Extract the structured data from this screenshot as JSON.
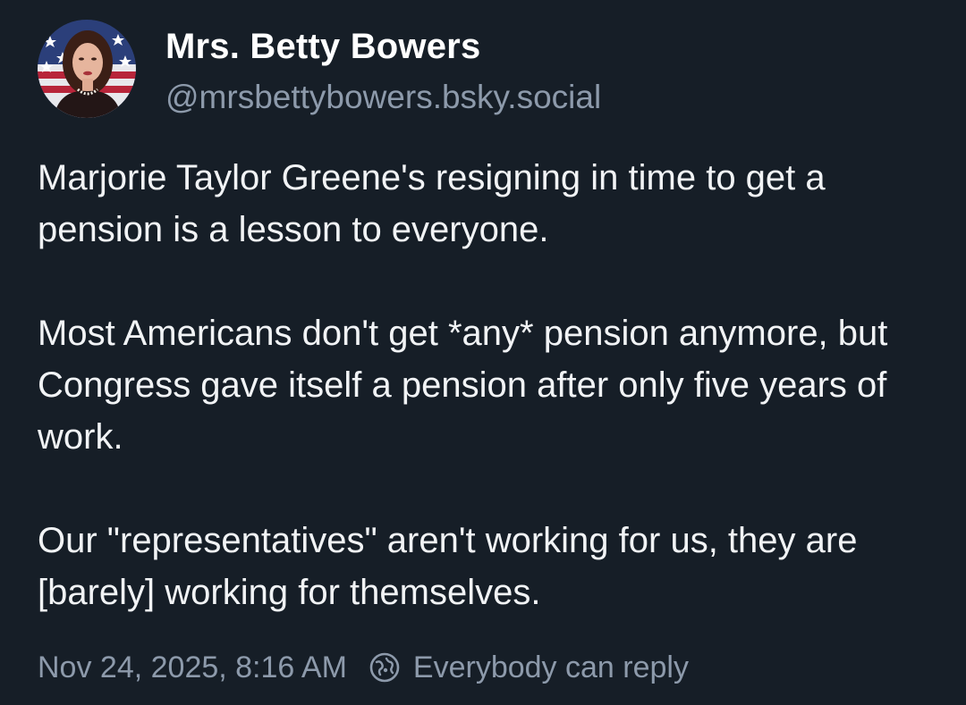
{
  "author": {
    "display_name": "Mrs. Betty Bowers",
    "handle": "@mrsbettybowers.bsky.social",
    "avatar_icon": "profile-photo-with-flag-background"
  },
  "post": {
    "paragraphs": [
      "Marjorie Taylor Greene's resigning in time to get a pension is a lesson to everyone.",
      "Most Americans don't get *any* pension anymore, but Congress gave itself a pension after only five years of work.",
      "Our \"representatives\" aren't working for us, they are [barely] working for themselves."
    ]
  },
  "meta": {
    "timestamp": "Nov 24, 2025, 8:16 AM",
    "reply_setting": "Everybody can reply",
    "reply_icon": "globe-icon"
  },
  "colors": {
    "background": "#161e27",
    "primary_text": "#ffffff",
    "secondary_text": "#8d9aab"
  }
}
